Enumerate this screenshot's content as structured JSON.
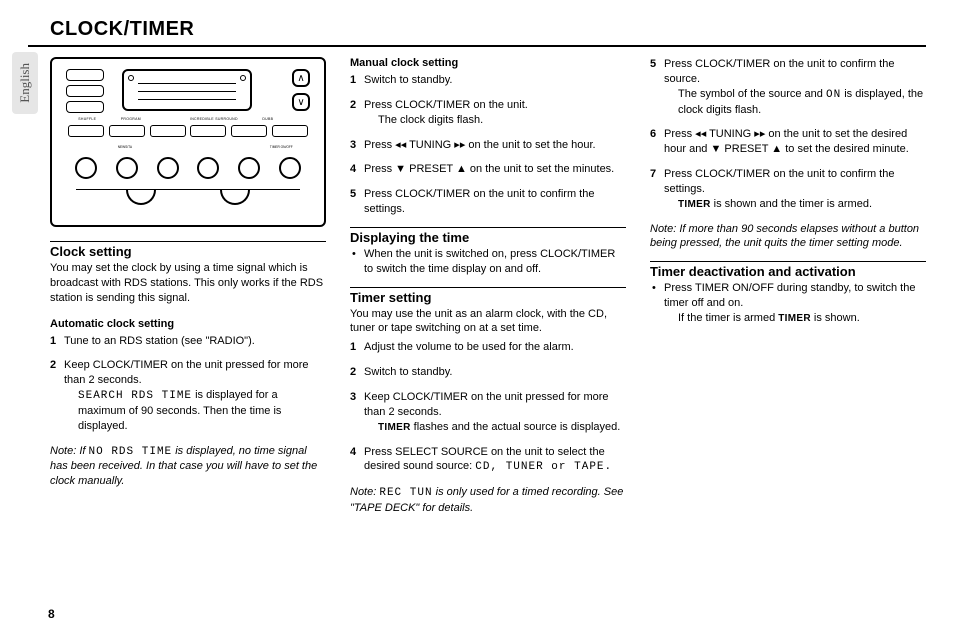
{
  "page_title": "CLOCK/TIMER",
  "language_tab": "English",
  "page_number": "8",
  "col1": {
    "h_clock_setting": "Clock setting",
    "clock_setting_intro": "You may set the clock by using a time signal which is broadcast with RDS stations. This only works if the RDS station is sending this signal.",
    "h_auto": "Automatic clock setting",
    "auto_steps": [
      "Tune to an RDS station (see \"RADIO\").",
      "Keep CLOCK/TIMER on the unit pressed for more than 2 seconds."
    ],
    "auto_step2_detail_pre": "SEARCH RDS TIME",
    "auto_step2_detail_post": " is displayed for a maximum of 90 seconds. Then the time is displayed.",
    "note1_pre": "Note: If ",
    "note1_seg": "NO RDS TIME",
    "note1_post": " is displayed, no time signal has been received. In that case you will have to set the clock manually."
  },
  "col2": {
    "h_manual": "Manual clock setting",
    "manual_steps": [
      "Switch to standby.",
      "Press CLOCK/TIMER on the unit.",
      "Press ◂◂ TUNING ▸▸ on the unit to set the hour.",
      "Press ▼ PRESET ▲ on the unit to set the minutes.",
      "Press CLOCK/TIMER on the unit to confirm the settings."
    ],
    "manual_step2_detail": "The clock digits flash.",
    "h_display": "Displaying the time",
    "display_bullet": "When the unit is switched on, press CLOCK/TIMER to switch the time display on and off.",
    "h_timer": "Timer setting",
    "timer_intro": "You may use the unit as an alarm clock, with the CD, tuner or tape switching on at a set time.",
    "timer_steps": [
      "Adjust the volume to be used for the alarm.",
      "Switch to standby.",
      "Keep CLOCK/TIMER on the unit pressed for more than 2 seconds.",
      "Press SELECT SOURCE on the unit to select the desired sound source: "
    ],
    "timer_step3_detail_pre": "TIMER",
    "timer_step3_detail_post": " flashes and the actual source is displayed.",
    "timer_step4_seg": "CD, TUNER or TAPE.",
    "note2_pre": "Note: ",
    "note2_seg": "REC TUN",
    "note2_post": " is only used for a timed recording. See \"TAPE DECK\" for details."
  },
  "col3": {
    "cont_steps": {
      "s5": "Press CLOCK/TIMER on the unit to confirm the source.",
      "s5_detail_pre": "The symbol of the source and ",
      "s5_detail_seg": "ON",
      "s5_detail_post": " is displayed, the clock digits flash.",
      "s6": "Press ◂◂ TUNING ▸▸ on the unit to set the desired hour and ▼ PRESET ▲ to set the desired minute.",
      "s7": "Press CLOCK/TIMER on the unit to confirm the settings.",
      "s7_detail_pre": "TIMER",
      "s7_detail_post": " is shown and the timer is armed."
    },
    "note3": "Note: If more than 90 seconds elapses without a button being pressed, the unit quits the timer setting mode.",
    "h_deact": "Timer deactivation and activation",
    "deact_bullet": "Press TIMER ON/OFF during standby, to switch the timer off and on.",
    "deact_detail_pre": "If the timer is armed ",
    "deact_detail_sc": "TIMER",
    "deact_detail_post": " is shown."
  }
}
